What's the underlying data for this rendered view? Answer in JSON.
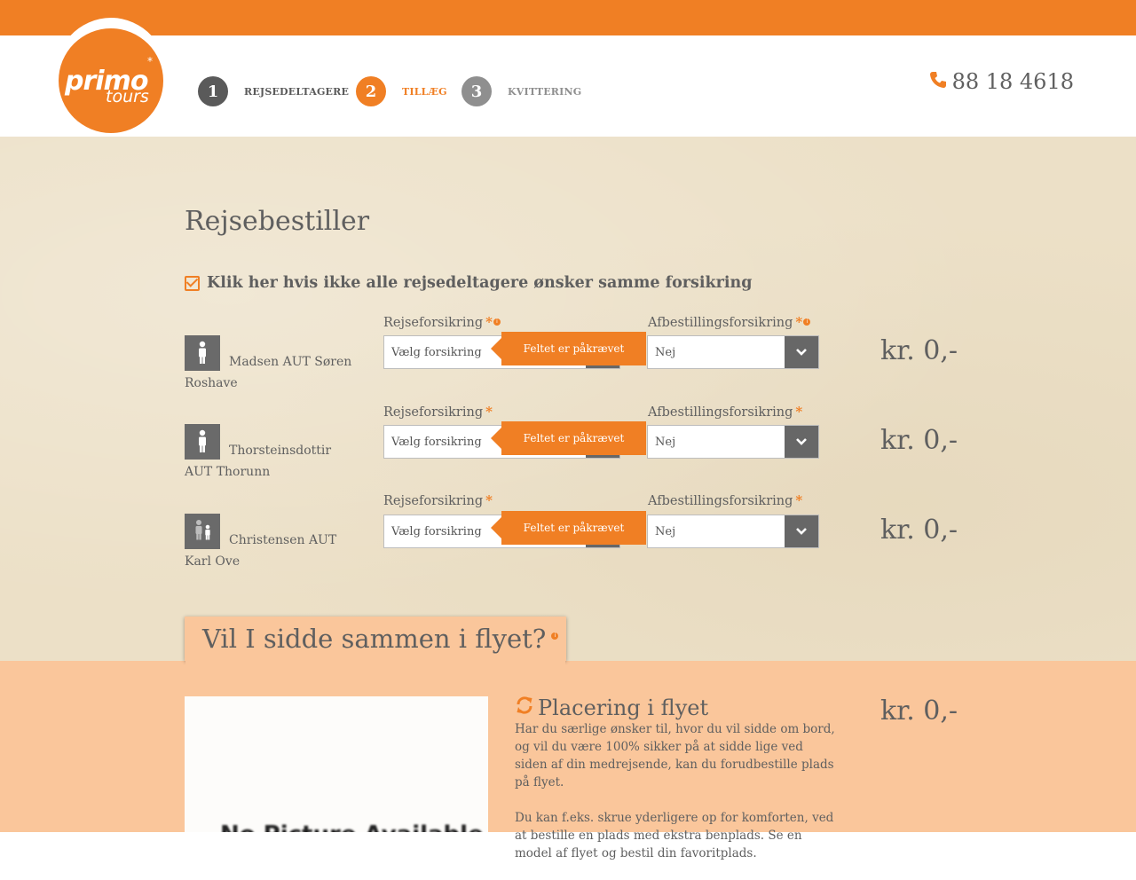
{
  "brand": {
    "logo_main": "primo",
    "logo_sub": "tours",
    "logo_star": "*",
    "accent": "#f07f24"
  },
  "steps": [
    {
      "num": "1",
      "label": "REJSEDELTAGERE"
    },
    {
      "num": "2",
      "label": "TILLÆG"
    },
    {
      "num": "3",
      "label": "KVITTERING"
    }
  ],
  "phone": {
    "icon": "phone-icon",
    "number": "88 18 4618"
  },
  "booker": {
    "title": "Rejsebestiller",
    "same_insurance_label": "Klik her hvis ikke alle rejsedeltagere ønsker samme forsikring"
  },
  "participants": [
    {
      "name": "Madsen AUT Søren Roshave",
      "travel_label": "Rejseforsikring",
      "travel_placeholder": "Vælg forsikring",
      "cancel_label": "Afbestillingsforsikring",
      "cancel_value": "Nej",
      "error": "Feltet er påkrævet",
      "price": "kr. 0,-"
    },
    {
      "name": "Thorsteinsdottir AUT Thorunn",
      "travel_label": "Rejseforsikring",
      "travel_placeholder": "Vælg forsikring",
      "cancel_label": "Afbestillingsforsikring",
      "cancel_value": "Nej",
      "error": "Feltet er påkrævet",
      "price": "kr. 0,-"
    },
    {
      "name": "Christensen AUT Karl Ove",
      "travel_label": "Rejseforsikring",
      "travel_placeholder": "Vælg forsikring",
      "cancel_label": "Afbestillingsforsikring",
      "cancel_value": "Nej",
      "error": "Feltet er påkrævet",
      "price": "kr. 0,-"
    }
  ],
  "required_mark": "*",
  "info_mark": "i",
  "seating": {
    "section_title": "Vil I sidde sammen i flyet?",
    "image_text": "No Picture Available",
    "title": "Placering i flyet",
    "para1": "Har du særlige ønsker til, hvor du vil sidde om bord, og vil du være 100% sikker på at sidde lige ved siden af din medrejsende, kan du forudbestille plads på flyet.",
    "para2": "Du kan f.eks. skrue yderligere op for komforten, ved at bestille en plads med ekstra benplads. Se en model af flyet og bestil din favoritplads.",
    "price": "kr. 0,-"
  }
}
